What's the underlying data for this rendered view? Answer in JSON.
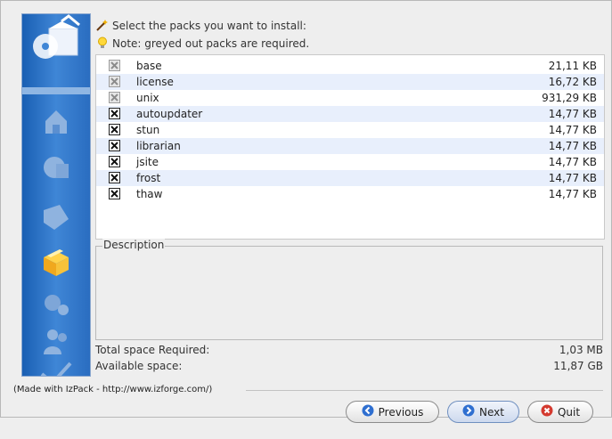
{
  "header": {
    "line1": "Select the packs you want to install:",
    "line2": "Note: greyed out packs are required."
  },
  "packs": [
    {
      "name": "base",
      "size": "21,11 KB",
      "required": true
    },
    {
      "name": "license",
      "size": "16,72 KB",
      "required": true
    },
    {
      "name": "unix",
      "size": "931,29 KB",
      "required": true
    },
    {
      "name": "autoupdater",
      "size": "14,77 KB",
      "required": false
    },
    {
      "name": "stun",
      "size": "14,77 KB",
      "required": false
    },
    {
      "name": "librarian",
      "size": "14,77 KB",
      "required": false
    },
    {
      "name": "jsite",
      "size": "14,77 KB",
      "required": false
    },
    {
      "name": "frost",
      "size": "14,77 KB",
      "required": false
    },
    {
      "name": "thaw",
      "size": "14,77 KB",
      "required": false
    }
  ],
  "description": {
    "legend": "Description",
    "text": ""
  },
  "space": {
    "required_label": "Total space Required:",
    "required_value": "1,03 MB",
    "available_label": "Available space:",
    "available_value": "11,87 GB"
  },
  "footer": {
    "made_with": "(Made with IzPack - http://www.izforge.com/)"
  },
  "buttons": {
    "previous": "Previous",
    "next": "Next",
    "quit": "Quit"
  },
  "colors": {
    "sidebar": "#2a6dc0",
    "row_alt": "#e8effc",
    "next_accent": "#6f8fbf"
  }
}
